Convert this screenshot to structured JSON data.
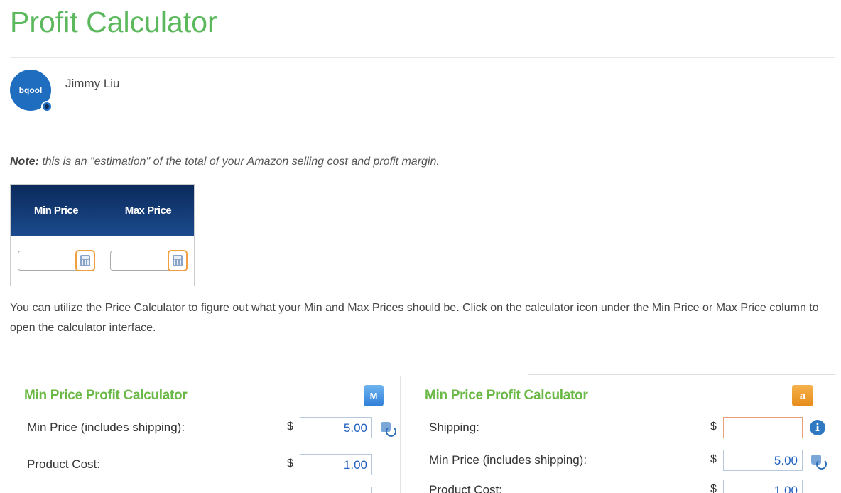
{
  "page": {
    "title": "Profit Calculator",
    "author": {
      "name": "Jimmy Liu",
      "avatar_text": "bqool"
    },
    "note": {
      "prefix": "Note:",
      "text": " this is an \"estimation\" of the total of your Amazon selling cost and profit margin."
    },
    "price_table": {
      "headers": [
        "Min Price",
        "Max Price"
      ]
    },
    "paragraph": "You can utilize the Price Calculator to figure out what your Min and Max Prices should be. Click on the calculator icon under the Min Price or Max Price column to open the calculator interface."
  },
  "left_calculator": {
    "title": "Min Price Profit Calculator",
    "badge": "M",
    "rows": [
      {
        "label": "Min Price (includes shipping):",
        "currency": "$",
        "value": "5.00"
      },
      {
        "label": "Product Cost:",
        "currency": "$",
        "value": "1.00"
      }
    ]
  },
  "right_calculator": {
    "title": "Min Price Profit Calculator",
    "badge": "a",
    "rows": [
      {
        "label": "Shipping:",
        "currency": "$",
        "value": ""
      },
      {
        "label": "Min Price (includes shipping):",
        "currency": "$",
        "value": "5.00"
      },
      {
        "label": "Product Cost:",
        "currency": "$",
        "value": "1.00"
      }
    ]
  },
  "colors": {
    "title_green": "#5cb85c",
    "header_navy": "#0b2a5b",
    "calc_title_green": "#6ab845",
    "value_blue": "#2060c0"
  }
}
